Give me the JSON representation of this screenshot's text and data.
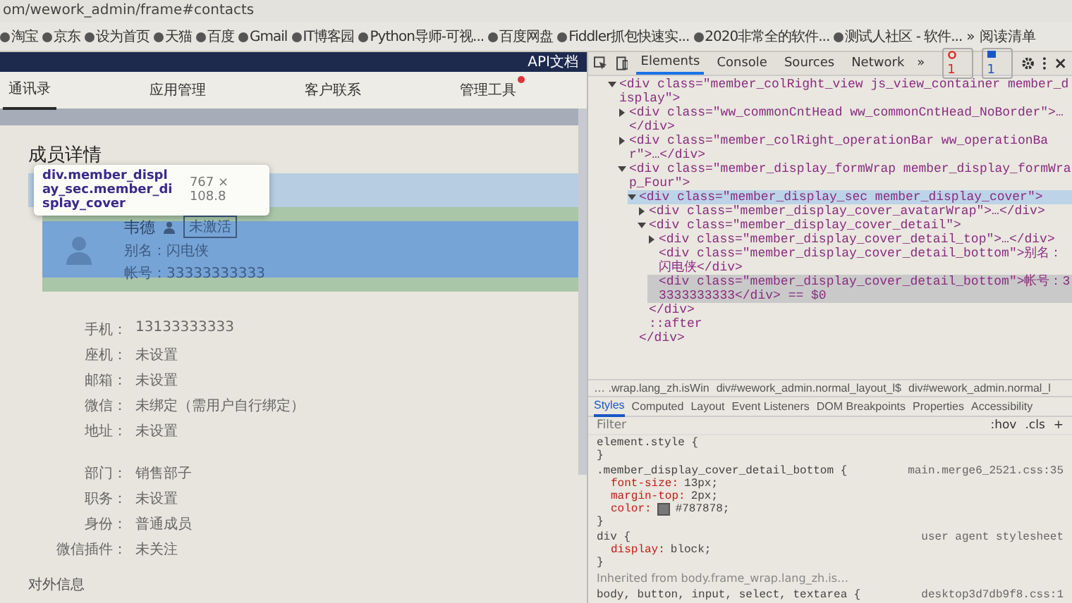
{
  "browser": {
    "url": "om/wework_admin/frame#contacts",
    "bookmarks": [
      {
        "label": "淘宝"
      },
      {
        "label": "京东"
      },
      {
        "label": "设为首页"
      },
      {
        "label": "天猫"
      },
      {
        "label": "百度"
      },
      {
        "label": "Gmail"
      },
      {
        "label": "IT博客园"
      },
      {
        "label": "Python导师-可视..."
      },
      {
        "label": "百度网盘"
      },
      {
        "label": "Fiddler抓包快速实..."
      },
      {
        "label": "2020非常全的软件..."
      },
      {
        "label": "测试人社区 - 软件..."
      }
    ],
    "more": "»",
    "reading_list": "阅读清单"
  },
  "page": {
    "header_link": "API文档",
    "nav": [
      {
        "label": "通讯录",
        "selected": true,
        "alert": false
      },
      {
        "label": "应用管理",
        "selected": false,
        "alert": false
      },
      {
        "label": "客户联系",
        "selected": false,
        "alert": false
      },
      {
        "label": "管理工具",
        "selected": false,
        "alert": true
      }
    ],
    "title": "成员详情",
    "tooltip": {
      "selector": "div.member_display_sec.member_display_cover",
      "size": "767 × 108.8"
    },
    "member": {
      "name": "韦德",
      "tag": "未激活",
      "alias": "别名：闪电侠",
      "account": "帐号：33333333333"
    },
    "contact_fields": [
      {
        "label": "手机：",
        "value": "13133333333"
      },
      {
        "label": "座机：",
        "value": "未设置"
      },
      {
        "label": "邮箱：",
        "value": "未设置"
      },
      {
        "label": "微信：",
        "value": "未绑定（需用户自行绑定）"
      },
      {
        "label": "地址：",
        "value": "未设置"
      }
    ],
    "org_fields": [
      {
        "label": "部门：",
        "value": "销售部子"
      },
      {
        "label": "职务：",
        "value": "未设置"
      },
      {
        "label": "身份：",
        "value": "普通成员"
      },
      {
        "label": "微信插件：",
        "value": "未关注"
      }
    ],
    "section_title": "对外信息"
  },
  "devtools": {
    "tabs": [
      {
        "label": "Elements",
        "selected": true
      },
      {
        "label": "Console",
        "selected": false
      },
      {
        "label": "Sources",
        "selected": false
      },
      {
        "label": "Network",
        "selected": false
      }
    ],
    "more": "»",
    "errors": "1",
    "messages": "1",
    "dom": [
      {
        "text": "<div class=\"member_colRight_view js_view_container member_display\">",
        "expanded": true,
        "selected": false,
        "hovered": false,
        "children": [
          {
            "text": "<div class=\"ww_commonCntHead ww_commonCntHead_NoBorder\">…</div>",
            "expanded": false,
            "selected": false,
            "hovered": false
          },
          {
            "text": "<div class=\"member_colRight_operationBar ww_operationBar\">…</div>",
            "expanded": false,
            "selected": false,
            "hovered": false
          },
          {
            "text": "<div class=\"member_display_formWrap member_display_formWrap_Four\">",
            "expanded": true,
            "selected": false,
            "hovered": false,
            "children": [
              {
                "text": "<div class=\"member_display_sec member_display_cover\">",
                "expanded": true,
                "selected": false,
                "hovered": true,
                "close": "</div>",
                "children": [
                  {
                    "text": "<div class=\"member_display_cover_avatarWrap\">…</div>",
                    "expanded": false,
                    "selected": false,
                    "hovered": false
                  },
                  {
                    "text": "<div class=\"member_display_cover_detail\">",
                    "expanded": true,
                    "selected": false,
                    "hovered": false,
                    "close": "</div>",
                    "children": [
                      {
                        "text": "<div class=\"member_display_cover_detail_top\">…</div>",
                        "expanded": false,
                        "selected": false,
                        "hovered": false
                      },
                      {
                        "text": "<div class=\"member_display_cover_detail_bottom\">别名：闪电侠</div>",
                        "selected": false,
                        "hovered": false
                      },
                      {
                        "text": "<div class=\"member_display_cover_detail_bottom\">帐号：33333333333</div> == $0",
                        "selected": true,
                        "hovered": false
                      }
                    ]
                  },
                  {
                    "text": "::after",
                    "selected": false,
                    "hovered": false
                  }
                ]
              }
            ]
          }
        ]
      }
    ],
    "breadcrumbs": [
      "… .wrap.lang_zh.isWin",
      "div#wework_admin.normal_layout_l$",
      "div#wework_admin.normal_l"
    ],
    "style_tabs": [
      {
        "label": "Styles",
        "selected": true
      },
      {
        "label": "Computed",
        "selected": false
      },
      {
        "label": "Layout",
        "selected": false
      },
      {
        "label": "Event Listeners",
        "selected": false
      },
      {
        "label": "DOM Breakpoints",
        "selected": false
      },
      {
        "label": "Properties",
        "selected": false
      },
      {
        "label": "Accessibility",
        "selected": false
      }
    ],
    "filter": {
      "placeholder": "Filter"
    },
    "hov": ":hov",
    "cls": ".cls",
    "add": "+",
    "rules": [
      {
        "selector": "element.style {",
        "end": "}"
      },
      {
        "selector": ".member_display_cover_detail_bottom {",
        "source": "main.merge6_2521.css:35",
        "decls": [
          {
            "prop": "font-size:",
            "value": "13px;"
          },
          {
            "prop": "margin-top:",
            "value": "2px;"
          },
          {
            "prop": "color:",
            "value": "#787878;",
            "color": "#787878"
          }
        ],
        "end": "}"
      },
      {
        "selector": "div {",
        "source": "user agent stylesheet",
        "decls": [
          {
            "prop": "display:",
            "value": "block;"
          }
        ],
        "end": "}"
      }
    ],
    "inherited": "Inherited from body.frame_wrap.lang_zh.is…",
    "last_rule": {
      "selector": "body, button, input, select, textarea {",
      "source": "desktop3d7db9f8.css:1"
    }
  }
}
